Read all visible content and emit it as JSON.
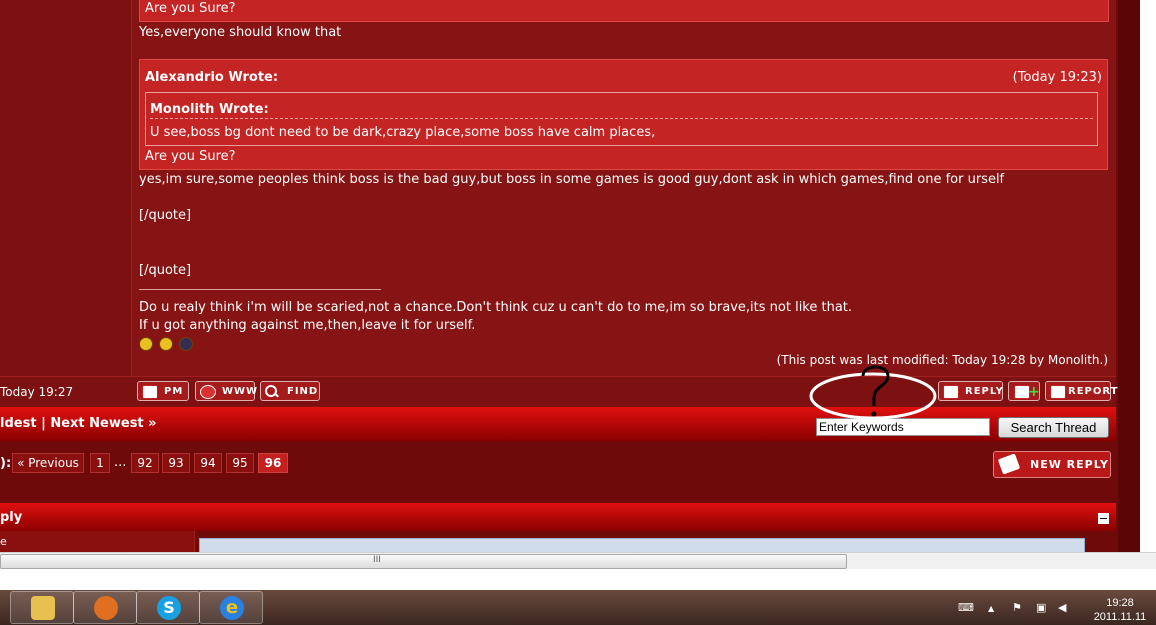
{
  "post": {
    "top_quote_tail": "Are you Sure?",
    "reply_line": "Yes,everyone should know that",
    "quote_outer_author": "Alexandrio Wrote:",
    "quote_outer_date": "(Today 19:23)",
    "quote_inner_author": "Monolith Wrote:",
    "quote_inner_body": "U see,boss bg dont need to be dark,crazy place,some boss have calm places,",
    "quote_outer_tail": "Are you Sure?",
    "body_line": "yes,im sure,some peoples think boss is the bad guy,but boss in some games is good guy,dont ask in which games,find one for urself",
    "close_tag_1": "[/quote]",
    "close_tag_2": "[/quote]",
    "signature_line_1": "Do u realy think i'm will be scaried,not a chance.Don't think cuz u can't do to me,im so brave,its not like that.",
    "signature_line_2": "If u got anything against me,then,leave it for urself.",
    "smilies": [
      "angry-smiley-icon",
      "angry-smiley-icon",
      "devil-smiley-icon"
    ],
    "modified_note": "(This post was last modified: Today 19:28 by Monolith.)",
    "post_time": "Today 19:27"
  },
  "post_buttons": {
    "pm": "PM",
    "www": "WWW",
    "find": "FIND",
    "reply": "REPLY",
    "report": "REPORT"
  },
  "thread_nav": {
    "prev_oldest": "ldest",
    "separator": "|",
    "next_newest": "Next Newest »"
  },
  "search": {
    "placeholder": "Enter Keywords",
    "button": "Search Thread"
  },
  "pagination": {
    "label": "):",
    "previous": "« Previous",
    "first": "1",
    "ellipsis": "...",
    "pages": [
      "92",
      "93",
      "94",
      "95"
    ],
    "current": "96"
  },
  "new_reply_label": "NEW REPLY",
  "quick_reply": {
    "title": "ply",
    "row_label": "e"
  },
  "taskbar": {
    "apps": [
      "folder-icon",
      "media-player-icon",
      "skype-icon",
      "internet-explorer-icon"
    ],
    "clock_time": "19:28",
    "clock_date": "2011.11.11"
  },
  "colors": {
    "page_bg": "#6e0a0a",
    "post_bg": "#861414",
    "quote_bg": "#c42424",
    "bar_red": "#e01010"
  }
}
